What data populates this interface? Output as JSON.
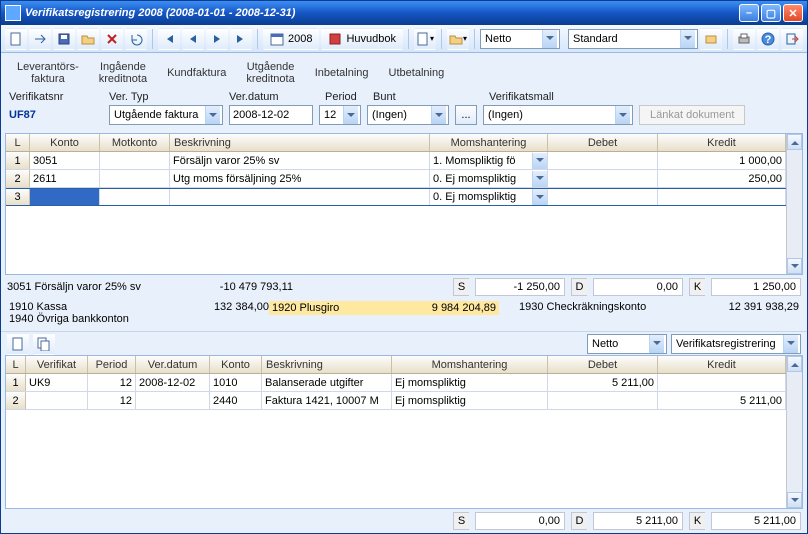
{
  "titlebar": {
    "text": "Verifikatsregistrering 2008 (2008-01-01 - 2008-12-31)"
  },
  "toolbar": {
    "year": "2008",
    "huvudbok": "Huvudbok",
    "dd1": "Netto",
    "dd2": "Standard"
  },
  "tabs": {
    "t1": "Leverantörs-\nfaktura",
    "t2": "Ingående\nkreditnota",
    "t3": "Kundfaktura",
    "t4": "Utgående\nkreditnota",
    "t5": "Inbetalning",
    "t6": "Utbetalning"
  },
  "fields": {
    "lbl_verifnr": "Verifikatsnr",
    "lbl_vertyp": "Ver. Typ",
    "lbl_verdatum": "Ver.datum",
    "lbl_period": "Period",
    "lbl_bunt": "Bunt",
    "lbl_verifmall": "Verifikatsmall",
    "verifnr": "UF87",
    "vertyp": "Utgående faktura",
    "verdatum": "2008-12-02",
    "period": "12",
    "bunt": "(Ingen)",
    "verifmall": "(Ingen)",
    "linked_doc": "Länkat dokument"
  },
  "grid1": {
    "headers": {
      "l": "L",
      "konto": "Konto",
      "motkonto": "Motkonto",
      "beskr": "Beskrivning",
      "moms": "Momshantering",
      "debet": "Debet",
      "kredit": "Kredit"
    },
    "rows": [
      {
        "n": "1",
        "konto": "3051",
        "motkonto": "",
        "beskr": "Försäljn varor 25% sv",
        "moms": "1. Momspliktig fö",
        "debet": "",
        "kredit": "1 000,00"
      },
      {
        "n": "2",
        "konto": "2611",
        "motkonto": "",
        "beskr": "Utg moms försäljning 25%",
        "moms": "0. Ej momspliktig",
        "debet": "",
        "kredit": "250,00"
      },
      {
        "n": "3",
        "konto": "",
        "motkonto": "",
        "beskr": "",
        "moms": "0. Ej momspliktig",
        "debet": "",
        "kredit": ""
      }
    ]
  },
  "summary1": {
    "left_acct": "3051 Försäljn varor 25% sv",
    "left_val": "-10 479 793,11",
    "s": "-1 250,00",
    "d": "0,00",
    "k": "1 250,00"
  },
  "accounts": {
    "a1_name": "1910 Kassa",
    "a1_val": "132 384,00",
    "a2_name": "1920 Plusgiro",
    "a2_val": "9 984 204,89",
    "a3_name": "1930 Checkräkningskonto",
    "a3_val": "12 391 938,29",
    "a4_name": "1940 Övriga bankkonton",
    "a4_val": ""
  },
  "mini": {
    "dd1": "Netto",
    "dd2": "Verifikatsregistrering"
  },
  "grid2": {
    "headers": {
      "l": "L",
      "verif": "Verifikat",
      "period": "Period",
      "verdatum": "Ver.datum",
      "konto": "Konto",
      "beskr": "Beskrivning",
      "moms": "Momshantering",
      "debet": "Debet",
      "kredit": "Kredit"
    },
    "rows": [
      {
        "n": "1",
        "verif": "UK9",
        "period": "12",
        "verdatum": "2008-12-02",
        "konto": "1010",
        "beskr": "Balanserade utgifter",
        "moms": "Ej momspliktig",
        "debet": "5 211,00",
        "kredit": ""
      },
      {
        "n": "2",
        "verif": "",
        "period": "12",
        "verdatum": "",
        "konto": "2440",
        "beskr": "Faktura 1421, 10007 M",
        "moms": "Ej momspliktig",
        "debet": "",
        "kredit": "5 211,00"
      }
    ]
  },
  "summary2": {
    "s": "0,00",
    "d": "5 211,00",
    "k": "5 211,00"
  },
  "sdk": {
    "s": "S",
    "d": "D",
    "k": "K"
  }
}
